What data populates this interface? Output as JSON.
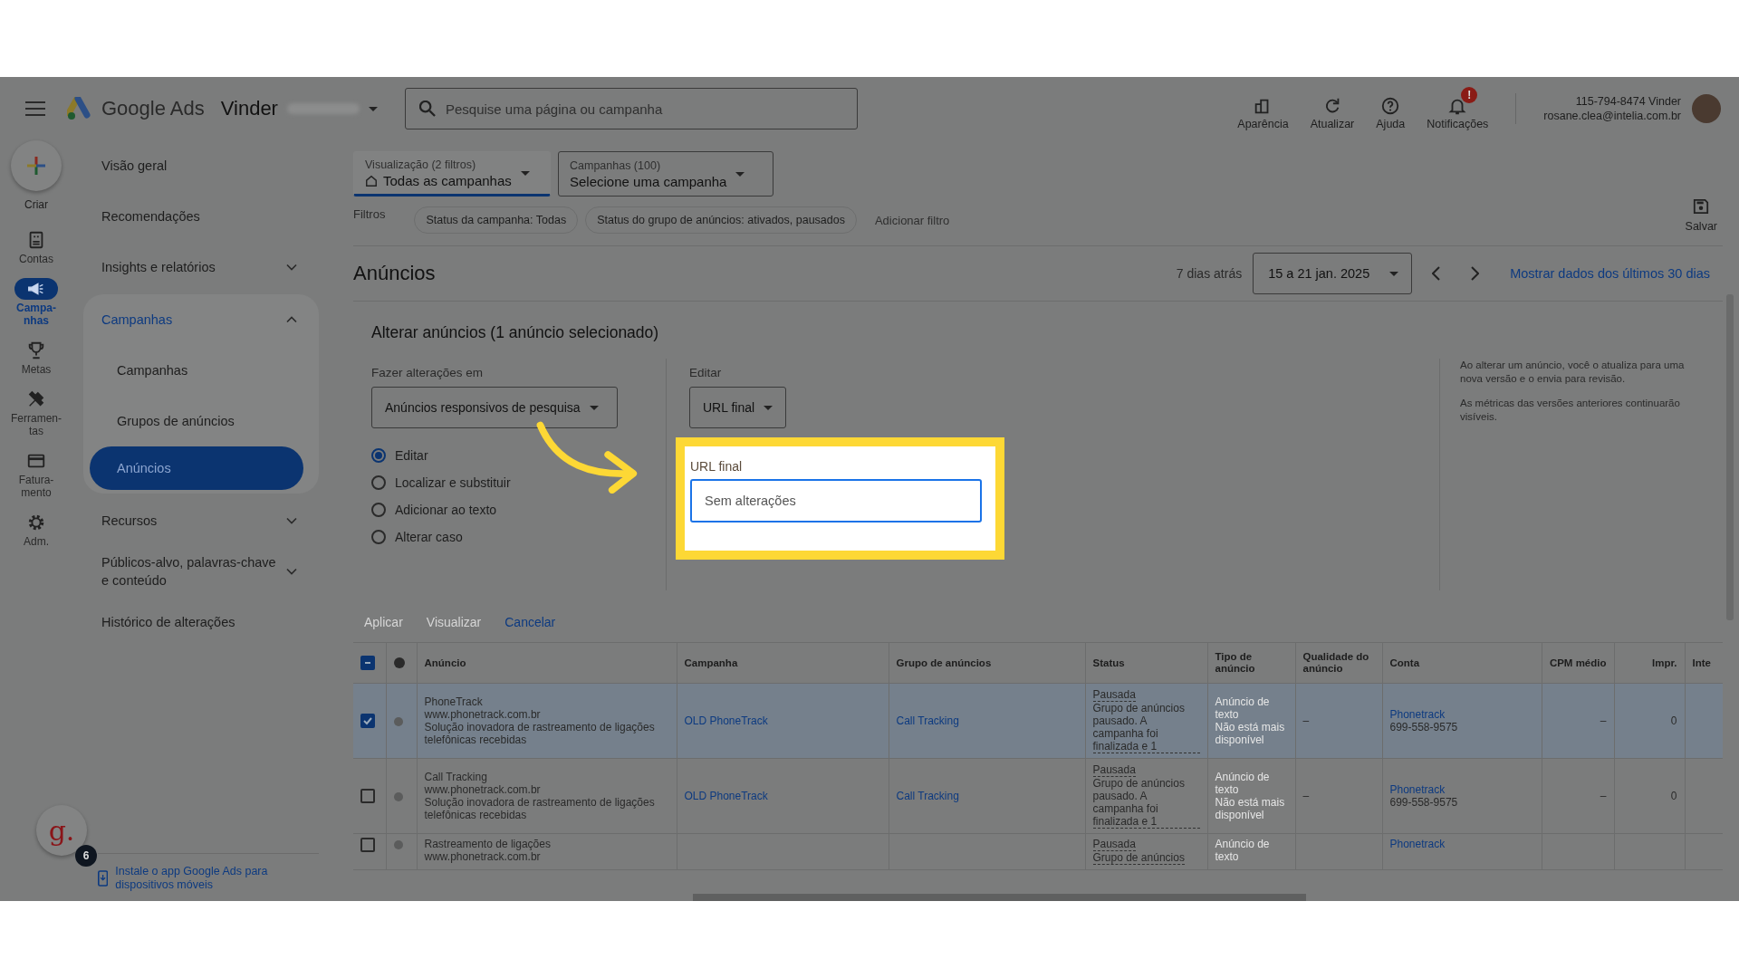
{
  "top_bar": {
    "product": "Google Ads",
    "account": "Vinder",
    "search": {
      "placeholder": "Pesquise uma página ou campanha"
    },
    "actions": [
      {
        "kind": "appearance",
        "label": "Aparência"
      },
      {
        "kind": "refresh",
        "label": "Atualizar"
      },
      {
        "kind": "help",
        "label": "Ajuda"
      },
      {
        "kind": "bell",
        "label": "Notificações",
        "badge": "!"
      }
    ],
    "user": {
      "id_line": "115-794-8474 Vinder",
      "email": "rosane.clea@intelia.com.br"
    }
  },
  "rail": {
    "create": "Criar",
    "items": [
      {
        "kind": "accounts",
        "label": "Contas",
        "selected": false
      },
      {
        "kind": "megaphone",
        "label": "Campa-nhas",
        "selected": true
      },
      {
        "kind": "trophy",
        "label": "Metas",
        "selected": false
      },
      {
        "kind": "tools",
        "label": "Ferramen-tas",
        "selected": false
      },
      {
        "kind": "card",
        "label": "Fatura-mento",
        "selected": false
      },
      {
        "kind": "gear",
        "label": "Adm.",
        "selected": false
      }
    ]
  },
  "nav": {
    "items": [
      {
        "label": "Visão geral",
        "kind": "link",
        "selected": false
      },
      {
        "label": "Recomendações",
        "kind": "link",
        "selected": false
      },
      {
        "label": "Insights e relatórios",
        "kind": "group",
        "expanded": false,
        "selected": false
      },
      {
        "label": "Campanhas",
        "kind": "group",
        "expanded": true,
        "selected": true,
        "children": [
          {
            "label": "Campanhas",
            "selected": false
          },
          {
            "label": "Grupos de anúncios",
            "selected": false
          },
          {
            "label": "Anúncios",
            "selected": true
          }
        ]
      },
      {
        "label": "Recursos",
        "kind": "group",
        "expanded": false,
        "selected": false
      },
      {
        "label": "Públicos-alvo, palavras-chave e conteúdo",
        "kind": "group",
        "expanded": false,
        "selected": false
      },
      {
        "label": "Histórico de alterações",
        "kind": "link",
        "selected": false
      }
    ],
    "helper_logo": "g.",
    "helper_badge": "6",
    "install_app": "Instale o app Google Ads para dispositivos móveis"
  },
  "filters": {
    "view": {
      "label": "Visualização (2 filtros)",
      "value": "Todas as campanhas"
    },
    "campaigns": {
      "label": "Campanhas (100)",
      "value": "Selecione uma campanha"
    },
    "filters_label": "Filtros",
    "chips": [
      "Status da campanha: Todas",
      "Status do grupo de anúncios: ativados, pausados"
    ],
    "add_filter": "Adicionar filtro",
    "save": "Salvar"
  },
  "page": {
    "title": "Anúncios",
    "date_hint": "7 dias atrás",
    "date_range": "15 a 21 jan. 2025",
    "last_30": "Mostrar dados dos últimos 30 dias"
  },
  "edit_panel": {
    "title": "Alterar anúncios (1 anúncio selecionado)",
    "make_changes_label": "Fazer alterações em",
    "ad_type": "Anúncios responsivos de pesquisa",
    "options": [
      {
        "label": "Editar",
        "selected": true
      },
      {
        "label": "Localizar e substituir",
        "selected": false
      },
      {
        "label": "Adicionar ao texto",
        "selected": false
      },
      {
        "label": "Alterar caso",
        "selected": false
      }
    ],
    "edit_label": "Editar",
    "edit_field": "URL final",
    "url_field": {
      "label": "URL final",
      "placeholder": "Sem alterações"
    },
    "info": [
      "Ao alterar um anúncio, você o atualiza para uma nova versão e o envia para revisão.",
      "As métricas das versões anteriores continuarão visíveis."
    ],
    "actions": [
      {
        "label": "Aplicar",
        "disabled": true
      },
      {
        "label": "Visualizar",
        "disabled": true
      },
      {
        "label": "Cancelar",
        "disabled": false
      }
    ]
  },
  "table": {
    "all_partial": true,
    "columns": [
      "Anúncio",
      "Campanha",
      "Grupo de anúncios",
      "Status",
      "Tipo de anúncio",
      "Qualidade do anúncio",
      "Conta",
      "CPM médio",
      "Impr.",
      "Inte"
    ],
    "rows": [
      {
        "checked": true,
        "ad": [
          "PhoneTrack",
          "www.phonetrack.com.br",
          "Solução inovadora de rastreamento de ligações telefônicas recebidas"
        ],
        "campaign": "OLD PhoneTrack",
        "ad_group": "Call Tracking",
        "status": [
          "Pausada",
          "Grupo de anúncios pausado. A campanha foi finalizada e 1"
        ],
        "type": [
          "Anúncio de texto",
          "Não está mais disponível"
        ],
        "quality": "–",
        "account": [
          "Phonetrack",
          "699-558-9575"
        ],
        "cpm": "–",
        "impr": "0"
      },
      {
        "checked": false,
        "ad": [
          "Call Tracking",
          "www.phonetrack.com.br",
          "Solução inovadora de rastreamento de ligações telefônicas recebidas"
        ],
        "campaign": "OLD PhoneTrack",
        "ad_group": "Call Tracking",
        "status": [
          "Pausada",
          "Grupo de anúncios pausado. A campanha foi finalizada e 1"
        ],
        "type": [
          "Anúncio de texto",
          "Não está mais disponível"
        ],
        "quality": "–",
        "account": [
          "Phonetrack",
          "699-558-9575"
        ],
        "cpm": "–",
        "impr": "0"
      },
      {
        "checked": false,
        "ad": [
          "Rastreamento de ligações",
          "www.phonetrack.com.br"
        ],
        "status": [
          "Pausada",
          "Grupo de anúncios"
        ],
        "type": [
          "Anúncio de texto"
        ],
        "account": [
          "Phonetrack"
        ]
      }
    ]
  }
}
